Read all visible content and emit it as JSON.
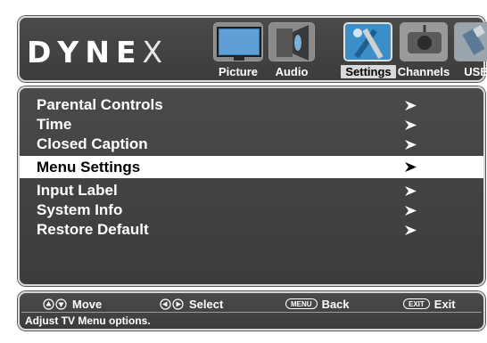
{
  "brand": {
    "letters": [
      "D",
      "Y",
      "N",
      "E",
      "X"
    ]
  },
  "tabs": [
    {
      "label": "Picture",
      "icon": "picture-icon",
      "active": false
    },
    {
      "label": "Audio",
      "icon": "audio-icon",
      "active": false
    },
    {
      "label": "Settings",
      "icon": "settings-icon",
      "active": true
    },
    {
      "label": "Channels",
      "icon": "channels-icon",
      "active": false
    },
    {
      "label": "USB",
      "icon": "usb-icon",
      "active": false
    }
  ],
  "menu": {
    "items": [
      {
        "label": "Parental Controls",
        "selected": false
      },
      {
        "label": "Time",
        "selected": false
      },
      {
        "label": "Closed Caption",
        "selected": false
      },
      {
        "label": "Menu Settings",
        "selected": true
      },
      {
        "label": "Input Label",
        "selected": false
      },
      {
        "label": "System Info",
        "selected": false
      },
      {
        "label": "Restore Default",
        "selected": false
      }
    ]
  },
  "footer": {
    "move_label": "Move",
    "select_label": "Select",
    "back_key": "MENU",
    "back_label": "Back",
    "exit_key": "EXIT",
    "exit_label": "Exit",
    "status": "Adjust TV Menu options."
  },
  "colors": {
    "panel": "#444444",
    "selected_bg": "#ffffff",
    "text": "#ffffff"
  }
}
